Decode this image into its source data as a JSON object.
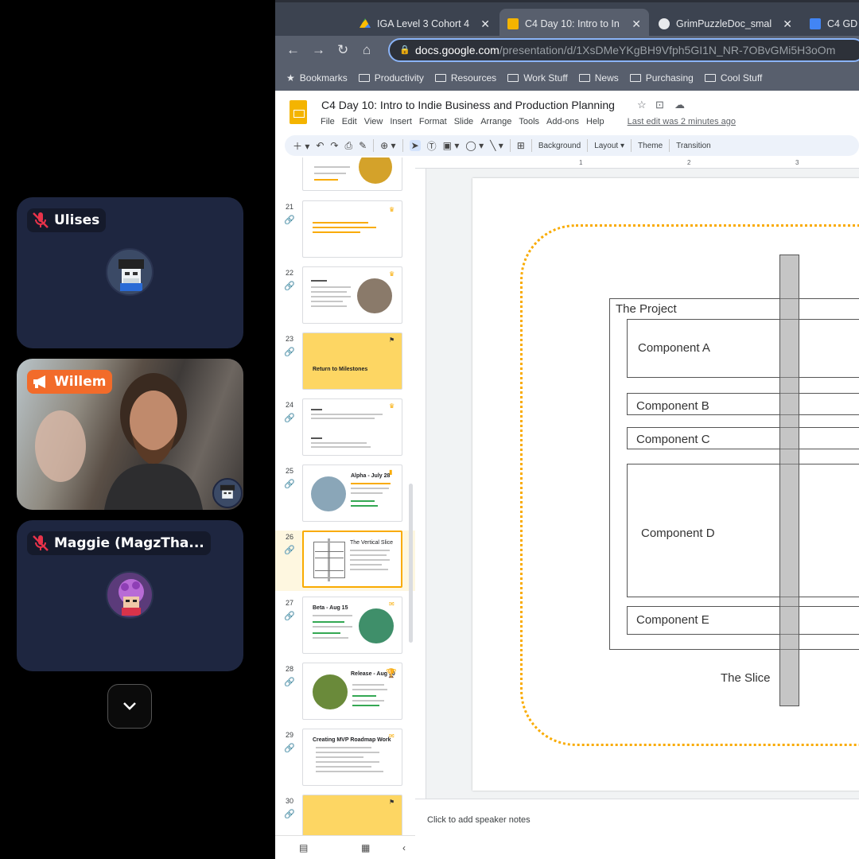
{
  "call": {
    "participants": [
      {
        "name": "Ulises",
        "muted": true
      },
      {
        "name": "Willem",
        "speaking": true
      },
      {
        "name": "Maggie (MagzTha...",
        "muted": true
      }
    ]
  },
  "browser": {
    "tabs": [
      {
        "label": "IGA Level 3 Cohort 4",
        "favicon": "google-drive-icon"
      },
      {
        "label": "C4 Day 10: Intro to In",
        "favicon": "google-slides-icon",
        "active": true
      },
      {
        "label": "GrimPuzzleDoc_smal",
        "favicon": "globe-icon"
      },
      {
        "label": "C4 GD",
        "favicon": "google-docs-icon"
      }
    ],
    "url_host": "docs.google.com",
    "url_path": "/presentation/d/1XsDMeYKgBH9Vfph5GI1N_NR-7OBvGMi5H3oOm",
    "bookmarks": [
      "Bookmarks",
      "Productivity",
      "Resources",
      "Work Stuff",
      "News",
      "Purchasing",
      "Cool Stuff"
    ]
  },
  "slides": {
    "title": "C4 Day 10: Intro to Indie Business and Production Planning",
    "menus": [
      "File",
      "Edit",
      "View",
      "Insert",
      "Format",
      "Slide",
      "Arrange",
      "Tools",
      "Add-ons",
      "Help"
    ],
    "last_edit": "Last edit was 2 minutes ago",
    "toolbar": {
      "background": "Background",
      "layout": "Layout",
      "theme": "Theme",
      "transition": "Transition"
    },
    "thumbnails": [
      {
        "num": "21"
      },
      {
        "num": "22"
      },
      {
        "num": "23",
        "title": "Return to Milestones"
      },
      {
        "num": "24"
      },
      {
        "num": "25",
        "title": "Alpha - July 28"
      },
      {
        "num": "26",
        "title": "The Vertical Slice",
        "current": true
      },
      {
        "num": "27",
        "title": "Beta - Aug 15"
      },
      {
        "num": "28",
        "title": "Release - Aug 30"
      },
      {
        "num": "29",
        "title": "Creating MVP Roadmap Work"
      },
      {
        "num": "30"
      }
    ],
    "ruler_marks": [
      "1",
      "2",
      "3"
    ],
    "slide": {
      "project_label": "The Project",
      "components": [
        "Component A",
        "Component B",
        "Component C",
        "Component D",
        "Component E"
      ],
      "slice_label": "The Slice"
    },
    "speaker_notes": "Click to add speaker notes"
  },
  "colors": {
    "accent": "#f9ab00",
    "speaker": "#f26b2a",
    "tile": "#1e2640"
  }
}
